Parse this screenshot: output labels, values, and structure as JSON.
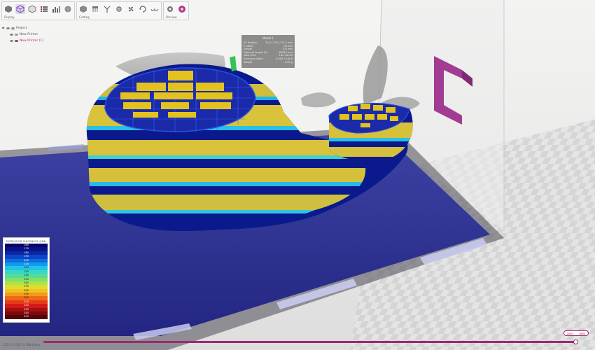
{
  "toolbar": {
    "groups": [
      {
        "label": "Display",
        "icons": [
          "cube-solid-icon",
          "cube-outline-icon",
          "cube-transparent-icon",
          "list-icon",
          "histogram-icon",
          "sphere-icon"
        ],
        "active_index": 1
      },
      {
        "label": "Cutting",
        "icons": [
          "cube-cut-icon",
          "support-icon",
          "y-axis-icon",
          "gear-icon",
          "fan-icon",
          "refresh-icon",
          "glasses-icon"
        ]
      },
      {
        "label": "Preview",
        "icons": [
          "settings-gear-icon",
          "print-color-icon"
        ]
      }
    ]
  },
  "tree": {
    "project_label": "Project",
    "printers": [
      {
        "name": "New Printer",
        "selected": false
      },
      {
        "name": "New Printer (1)",
        "selected": true
      }
    ]
  },
  "info": {
    "title": "Model 1",
    "rows": [
      {
        "label": "XY Position",
        "value": "10.0 / 20.0 / 21.2 mm"
      },
      {
        "label": "Z offset",
        "value": "28 mm"
      },
      {
        "label": "Length",
        "value": "0.0 mm"
      },
      {
        "label": "Filament length (S)",
        "value": "68345 mm"
      },
      {
        "label": "Total time",
        "value": "10h 34min"
      },
      {
        "label": "Extrusion width",
        "value": "0.400 / 0.400"
      },
      {
        "label": "Weight",
        "value": "5.32 g"
      }
    ]
  },
  "legend": {
    "title": "EXTRUSION THICKNESS (MM)",
    "rows": [
      {
        "value": "160",
        "color": "#08066a",
        "text_color": "#ffffff"
      },
      {
        "value": "170",
        "color": "#0a1385",
        "text_color": "#ffffff"
      },
      {
        "value": "180",
        "color": "#0b27a8",
        "text_color": "#ffffff"
      },
      {
        "value": "190",
        "color": "#0b46c9",
        "text_color": "#ffffff"
      },
      {
        "value": "200",
        "color": "#0c6fe0",
        "text_color": "#ffffff"
      },
      {
        "value": "210",
        "color": "#129be8",
        "text_color": "#ffffff"
      },
      {
        "value": "220",
        "color": "#1fc4e8",
        "text_color": "#1a1a1a"
      },
      {
        "value": "230",
        "color": "#36d8c4",
        "text_color": "#1a1a1a"
      },
      {
        "value": "240",
        "color": "#55dc97",
        "text_color": "#1a1a1a"
      },
      {
        "value": "250",
        "color": "#7ee06a",
        "text_color": "#1a1a1a"
      },
      {
        "value": "260",
        "color": "#aee247",
        "text_color": "#1a1a1a"
      },
      {
        "value": "270",
        "color": "#dcdd2e",
        "text_color": "#1a1a1a"
      },
      {
        "value": "280",
        "color": "#f0c420",
        "text_color": "#1a1a1a"
      },
      {
        "value": "290",
        "color": "#f29a1c",
        "text_color": "#1a1a1a"
      },
      {
        "value": "300",
        "color": "#ee6a1a",
        "text_color": "#1a1a1a"
      },
      {
        "value": "310",
        "color": "#e63c18",
        "text_color": "#ffffff"
      },
      {
        "value": "320",
        "color": "#d31a16",
        "text_color": "#ffffff"
      },
      {
        "value": "330",
        "color": "#a70f12",
        "text_color": "#ffffff"
      },
      {
        "value": "340",
        "color": "#7c0a0e",
        "text_color": "#ffffff"
      },
      {
        "value": "400",
        "color": "#520608",
        "text_color": "#ffffff"
      }
    ]
  },
  "bottom": {
    "dimensions": "155.3 x 119.7 x 108.0 mm",
    "layer_min": "1883",
    "layer_max": "1883"
  },
  "colors": {
    "accent": "#9b2a6e",
    "logo": "#a23b92",
    "bed": "#2b2f8f"
  }
}
